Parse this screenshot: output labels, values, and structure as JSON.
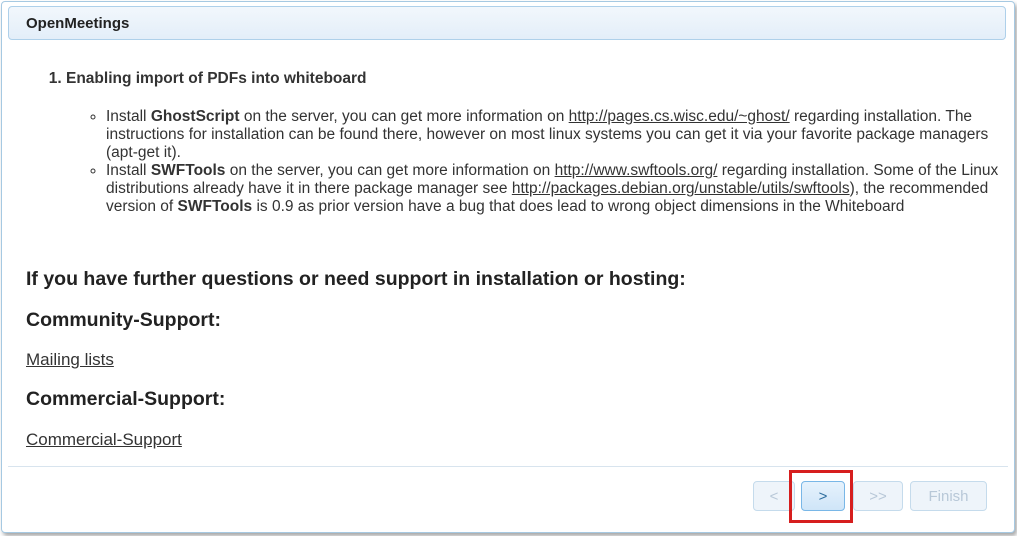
{
  "dialog": {
    "title": "OpenMeetings"
  },
  "steps": [
    {
      "title": "Enabling import of PDFs into whiteboard",
      "items": [
        {
          "pre": "Install ",
          "bold": "GhostScript",
          "mid": " on the server, you can get more information on ",
          "link": "http://pages.cs.wisc.edu/~ghost/",
          "post": " regarding installation. The instructions for installation can be found there, however on most linux systems you can get it via your favorite package managers (apt-get it)."
        },
        {
          "pre": "Install ",
          "bold": "SWFTools",
          "mid": " on the server, you can get more information on ",
          "link": "http://www.swftools.org/",
          "mid2": " regarding installation. Some of the Linux distributions already have it in there package manager see ",
          "link2": "http://packages.debian.org/unstable/utils/swftools",
          "mid3": "), the recommended version of ",
          "bold2": "SWFTools",
          "post": " is 0.9 as prior version have a bug that does lead to wrong object dimensions in the Whiteboard"
        }
      ]
    }
  ],
  "support": {
    "heading": "If you have further questions or need support in installation or hosting:",
    "community_heading": "Community-Support:",
    "community_link": "Mailing lists",
    "commercial_heading": "Commercial-Support:",
    "commercial_link": "Commercial-Support"
  },
  "footer": {
    "prev_label": "<",
    "next_label": ">",
    "last_label": ">>",
    "finish_label": "Finish"
  },
  "colors": {
    "highlight": "#d61e1e",
    "accent": "#2e6e9e"
  }
}
